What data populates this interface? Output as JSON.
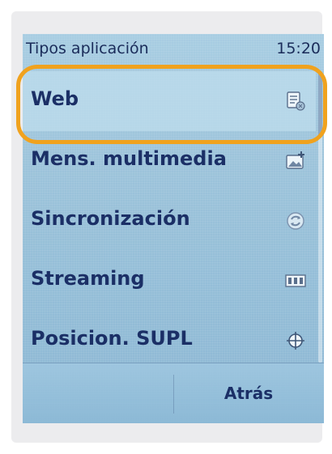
{
  "status": {
    "title": "Tipos aplicación",
    "clock": "15:20"
  },
  "list": {
    "items": [
      {
        "label": "Web",
        "icon": "web-page-icon",
        "selected": true
      },
      {
        "label": "Mens. multimedia",
        "icon": "multimedia-message-icon",
        "selected": false
      },
      {
        "label": "Sincronización",
        "icon": "sync-icon",
        "selected": false
      },
      {
        "label": "Streaming",
        "icon": "film-strip-icon",
        "selected": false
      },
      {
        "label": "Posicion. SUPL",
        "icon": "crosshair-icon",
        "selected": false
      }
    ]
  },
  "softkeys": {
    "right_label": "Atrás"
  },
  "colors": {
    "highlight": "#f0a21e",
    "text": "#1b2f66",
    "screen": "#9cc3da"
  }
}
